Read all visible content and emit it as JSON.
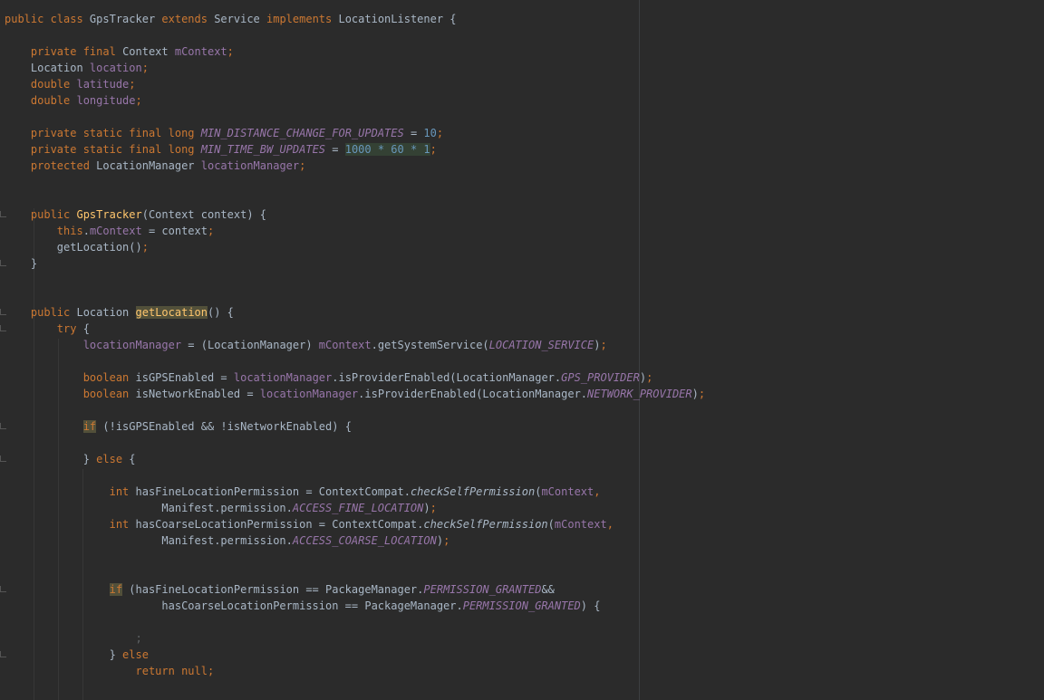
{
  "editor": {
    "language": "java",
    "lines": [
      [
        [
          "kw",
          "public class "
        ],
        [
          "p",
          "GpsTracker "
        ],
        [
          "kw",
          "extends "
        ],
        [
          "p",
          "Service "
        ],
        [
          "kw",
          "implements "
        ],
        [
          "p",
          "LocationListener {"
        ]
      ],
      [],
      [
        [
          "p",
          "    "
        ],
        [
          "kw",
          "private final "
        ],
        [
          "p",
          "Context "
        ],
        [
          "fld",
          "mContext"
        ],
        [
          "kw",
          ";"
        ]
      ],
      [
        [
          "p",
          "    Location "
        ],
        [
          "fld",
          "location"
        ],
        [
          "kw",
          ";"
        ]
      ],
      [
        [
          "p",
          "    "
        ],
        [
          "kw",
          "double "
        ],
        [
          "fld",
          "latitude"
        ],
        [
          "kw",
          ";"
        ]
      ],
      [
        [
          "p",
          "    "
        ],
        [
          "kw",
          "double "
        ],
        [
          "fld",
          "longitude"
        ],
        [
          "kw",
          ";"
        ]
      ],
      [],
      [
        [
          "p",
          "    "
        ],
        [
          "kw",
          "private static final long "
        ],
        [
          "cst",
          "MIN_DISTANCE_CHANGE_FOR_UPDATES"
        ],
        [
          "p",
          " = "
        ],
        [
          "num",
          "10"
        ],
        [
          "kw",
          ";"
        ]
      ],
      [
        [
          "p",
          "    "
        ],
        [
          "kw",
          "private static final long "
        ],
        [
          "cst",
          "MIN_TIME_BW_UPDATES"
        ],
        [
          "p",
          " = "
        ],
        [
          "hlnum",
          "1000 * 60 * 1"
        ],
        [
          "kw",
          ";"
        ]
      ],
      [
        [
          "p",
          "    "
        ],
        [
          "kw",
          "protected "
        ],
        [
          "p",
          "LocationManager "
        ],
        [
          "fld",
          "locationManager"
        ],
        [
          "kw",
          ";"
        ]
      ],
      [],
      [],
      [
        [
          "p",
          "    "
        ],
        [
          "kw",
          "public "
        ],
        [
          "fn",
          "GpsTracker"
        ],
        [
          "p",
          "(Context context) {"
        ]
      ],
      [
        [
          "p",
          "        "
        ],
        [
          "kw",
          "this"
        ],
        [
          "p",
          "."
        ],
        [
          "fld",
          "mContext"
        ],
        [
          "p",
          " = context"
        ],
        [
          "kw",
          ";"
        ]
      ],
      [
        [
          "p",
          "        getLocation()"
        ],
        [
          "kw",
          ";"
        ]
      ],
      [
        [
          "p",
          "    }"
        ]
      ],
      [],
      [],
      [
        [
          "p",
          "    "
        ],
        [
          "kw",
          "public "
        ],
        [
          "p",
          "Location "
        ],
        [
          "fnhl",
          "getLocation"
        ],
        [
          "p",
          "() {"
        ]
      ],
      [
        [
          "p",
          "        "
        ],
        [
          "kw",
          "try "
        ],
        [
          "p",
          "{"
        ]
      ],
      [
        [
          "p",
          "            "
        ],
        [
          "fld",
          "locationManager"
        ],
        [
          "p",
          " = (LocationManager) "
        ],
        [
          "fld",
          "mContext"
        ],
        [
          "p",
          ".getSystemService("
        ],
        [
          "cst",
          "LOCATION_SERVICE"
        ],
        [
          "p",
          ")"
        ],
        [
          "kw",
          ";"
        ]
      ],
      [],
      [
        [
          "p",
          "            "
        ],
        [
          "kw",
          "boolean "
        ],
        [
          "p",
          "isGPSEnabled = "
        ],
        [
          "fld",
          "locationManager"
        ],
        [
          "p",
          ".isProviderEnabled(LocationManager."
        ],
        [
          "cst",
          "GPS_PROVIDER"
        ],
        [
          "p",
          ")"
        ],
        [
          "kw",
          ";"
        ]
      ],
      [
        [
          "p",
          "            "
        ],
        [
          "kw",
          "boolean "
        ],
        [
          "p",
          "isNetworkEnabled = "
        ],
        [
          "fld",
          "locationManager"
        ],
        [
          "p",
          ".isProviderEnabled(LocationManager."
        ],
        [
          "cst",
          "NETWORK_PROVIDER"
        ],
        [
          "p",
          ")"
        ],
        [
          "kw",
          ";"
        ]
      ],
      [],
      [
        [
          "p",
          "            "
        ],
        [
          "kwhl",
          "if"
        ],
        [
          "p",
          " (!isGPSEnabled && !isNetworkEnabled) {"
        ]
      ],
      [],
      [
        [
          "p",
          "            } "
        ],
        [
          "kw",
          "else "
        ],
        [
          "p",
          "{"
        ]
      ],
      [],
      [
        [
          "p",
          "                "
        ],
        [
          "kw",
          "int "
        ],
        [
          "p",
          "hasFineLocationPermission = ContextCompat."
        ],
        [
          "stat",
          "checkSelfPermission"
        ],
        [
          "p",
          "("
        ],
        [
          "fld",
          "mContext"
        ],
        [
          "kw",
          ","
        ]
      ],
      [
        [
          "p",
          "                        Manifest.permission."
        ],
        [
          "cst",
          "ACCESS_FINE_LOCATION"
        ],
        [
          "p",
          ")"
        ],
        [
          "kw",
          ";"
        ]
      ],
      [
        [
          "p",
          "                "
        ],
        [
          "kw",
          "int "
        ],
        [
          "p",
          "hasCoarseLocationPermission = ContextCompat."
        ],
        [
          "stat",
          "checkSelfPermission"
        ],
        [
          "p",
          "("
        ],
        [
          "fld",
          "mContext"
        ],
        [
          "kw",
          ","
        ]
      ],
      [
        [
          "p",
          "                        Manifest.permission."
        ],
        [
          "cst",
          "ACCESS_COARSE_LOCATION"
        ],
        [
          "p",
          ")"
        ],
        [
          "kw",
          ";"
        ]
      ],
      [],
      [],
      [
        [
          "p",
          "                "
        ],
        [
          "kwhl",
          "if"
        ],
        [
          "p",
          " (hasFineLocationPermission == PackageManager."
        ],
        [
          "cst",
          "PERMISSION_GRANTED"
        ],
        [
          "p",
          "&&"
        ]
      ],
      [
        [
          "p",
          "                        hasCoarseLocationPermission == PackageManager."
        ],
        [
          "cst",
          "PERMISSION_GRANTED"
        ],
        [
          "p",
          ") {"
        ]
      ],
      [],
      [
        [
          "p",
          "                    "
        ],
        [
          "dim",
          ";"
        ]
      ],
      [
        [
          "p",
          "                } "
        ],
        [
          "kw",
          "else"
        ]
      ],
      [
        [
          "p",
          "                    "
        ],
        [
          "kw",
          "return null;"
        ]
      ]
    ]
  }
}
